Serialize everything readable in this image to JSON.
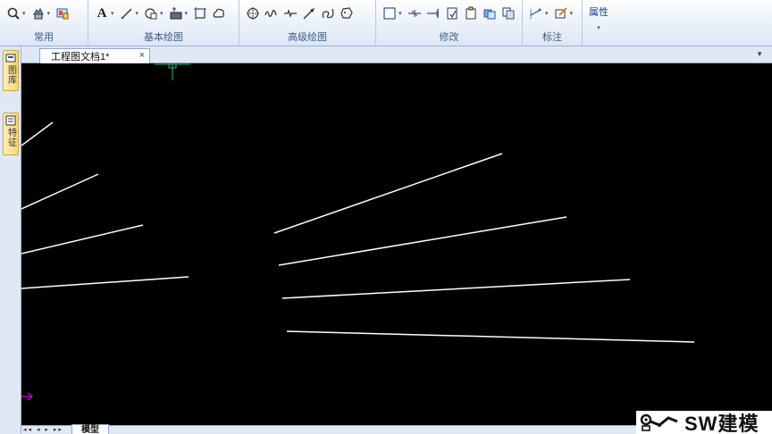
{
  "ribbon": {
    "groups": [
      {
        "caption": "常用"
      },
      {
        "caption": "基本绘图"
      },
      {
        "caption": "高级绘图"
      },
      {
        "caption": "修改"
      },
      {
        "caption": "标注"
      }
    ],
    "text_tool": "A",
    "properties_label": "属性"
  },
  "side_tabs": {
    "tab1": "图库",
    "tab2": "特征"
  },
  "document": {
    "tab_title": "工程图文档1*",
    "close_glyph": "×",
    "menu_glyph": "▼"
  },
  "bottom": {
    "nav_arrows": "◂◂ ◂ ▸ ▸▸",
    "model_tab": "模型"
  },
  "watermark": {
    "text": "SW建模"
  },
  "colors": {
    "canvas": "#000000",
    "lines": "#ffffff",
    "cursor": "#2bb673",
    "ucs_arrow": "#d400d4"
  }
}
